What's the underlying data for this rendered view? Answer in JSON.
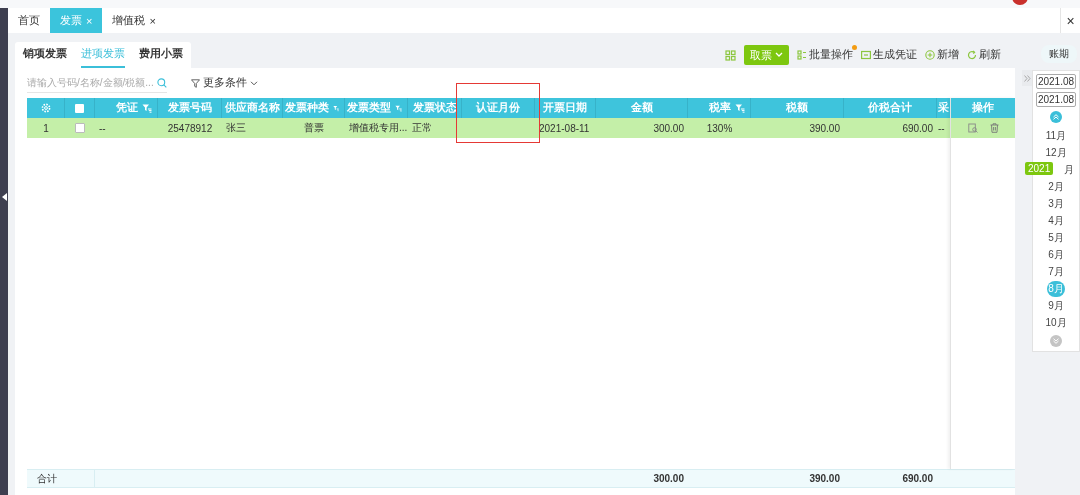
{
  "top_tabs": [
    {
      "label": "首页",
      "selected": false
    },
    {
      "label": "发票",
      "selected": true,
      "close": "×"
    },
    {
      "label": "增值税",
      "selected": false,
      "close": "×"
    }
  ],
  "window_close": "×",
  "sub_tabs": [
    {
      "label": "销项发票",
      "selected": false
    },
    {
      "label": "进项发票",
      "selected": true
    },
    {
      "label": "费用小票",
      "selected": false
    }
  ],
  "search": {
    "placeholder": "请输入号码/名称/金额/税额..."
  },
  "more_filters": {
    "label": "更多条件"
  },
  "toolbar": {
    "primary": {
      "label": "取票"
    },
    "actions": [
      {
        "label": "批量操作",
        "kind": "batch",
        "notification": true
      },
      {
        "label": "生成凭证",
        "kind": "voucher",
        "notification": false
      },
      {
        "label": "新增",
        "kind": "add",
        "notification": false
      },
      {
        "label": "刷新",
        "kind": "refresh",
        "notification": false
      }
    ]
  },
  "period": {
    "label": "账期",
    "start": "2021.08",
    "end": "2021.08",
    "year": "2021",
    "months": [
      {
        "label": "11月",
        "selected": false
      },
      {
        "label": "12月",
        "selected": false
      },
      {
        "label": "月",
        "selected": false
      },
      {
        "label": "2月",
        "selected": false
      },
      {
        "label": "3月",
        "selected": false
      },
      {
        "label": "4月",
        "selected": false
      },
      {
        "label": "5月",
        "selected": false
      },
      {
        "label": "6月",
        "selected": false
      },
      {
        "label": "7月",
        "selected": false
      },
      {
        "label": "8月",
        "selected": true
      },
      {
        "label": "9月",
        "selected": false
      },
      {
        "label": "10月",
        "selected": false
      }
    ]
  },
  "table": {
    "select_all": {
      "checked": false
    },
    "columns": [
      {
        "label": "凭证",
        "filter": true
      },
      {
        "label": "发票号码",
        "filter": false
      },
      {
        "label": "供应商名称",
        "filter": false
      },
      {
        "label": "发票种类",
        "filter": true
      },
      {
        "label": "发票类型",
        "filter": true
      },
      {
        "label": "发票状态",
        "filter": false
      },
      {
        "label": "认证月份",
        "filter": false
      },
      {
        "label": "开票日期",
        "filter": false
      },
      {
        "label": "金额",
        "filter": false
      },
      {
        "label": "税率",
        "filter": true
      },
      {
        "label": "税额",
        "filter": false
      },
      {
        "label": "价税合计",
        "filter": false
      },
      {
        "label": "采"
      }
    ],
    "actions_column": "操作",
    "rows": [
      {
        "index": "1",
        "checked": false,
        "selected": true,
        "cells": [
          "--",
          "25478912",
          "张三",
          "普票",
          "增值税专用...",
          "正常",
          null,
          "2021-08-11",
          "300.00",
          "130%",
          "390.00",
          "690.00",
          "--"
        ]
      }
    ],
    "totals": {
      "label": "合计",
      "cells": [
        null,
        null,
        null,
        null,
        null,
        null,
        null,
        null,
        "300.00",
        null,
        "390.00",
        "690.00",
        null
      ]
    }
  }
}
